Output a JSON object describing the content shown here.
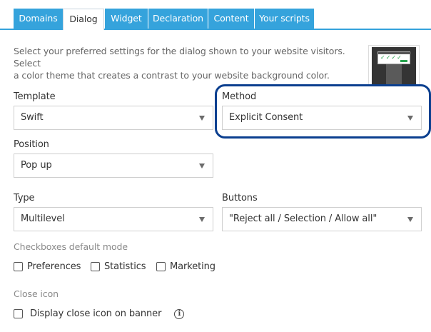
{
  "tabs": [
    {
      "label": "Domains",
      "active": false
    },
    {
      "label": "Dialog",
      "active": true
    },
    {
      "label": "Widget",
      "active": false
    },
    {
      "label": "Declaration",
      "active": false
    },
    {
      "label": "Content",
      "active": false
    },
    {
      "label": "Your scripts",
      "active": false
    }
  ],
  "intro": {
    "line1": "Select your preferred settings for the dialog shown to your website visitors. Select",
    "line2": "a color theme that creates a contrast to your website background color."
  },
  "template": {
    "label": "Template",
    "value": "Swift"
  },
  "method": {
    "label": "Method",
    "value": "Explicit Consent"
  },
  "position": {
    "label": "Position",
    "value": "Pop up"
  },
  "type": {
    "label": "Type",
    "value": "Multilevel"
  },
  "buttons": {
    "label": "Buttons",
    "value": "\"Reject all / Selection / Allow all\""
  },
  "checkboxes_mode": {
    "label": "Checkboxes default mode",
    "options": [
      {
        "label": "Preferences",
        "checked": false
      },
      {
        "label": "Statistics",
        "checked": false
      },
      {
        "label": "Marketing",
        "checked": false
      }
    ]
  },
  "close_icon": {
    "label": "Close icon",
    "option": {
      "label": "Display close icon on banner",
      "checked": false
    },
    "info_glyph": "i"
  },
  "preview": {
    "checks": "✓✓✓✓"
  },
  "colors": {
    "accent": "#35a3dc",
    "highlight": "#0b3f8f",
    "check_green": "#2aa44f"
  }
}
